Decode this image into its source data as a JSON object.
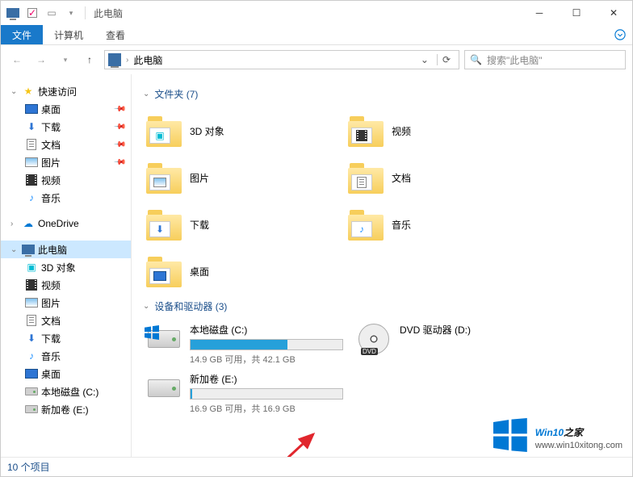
{
  "title": "此电脑",
  "ribbon": {
    "file": "文件",
    "computer": "计算机",
    "view": "查看"
  },
  "breadcrumb": "此电脑",
  "search_placeholder": "搜索\"此电脑\"",
  "sidebar": {
    "quick_access": "快速访问",
    "items_quick": [
      {
        "label": "桌面",
        "icon": "desktop",
        "pinned": true
      },
      {
        "label": "下载",
        "icon": "download",
        "pinned": true
      },
      {
        "label": "文档",
        "icon": "doc",
        "pinned": true
      },
      {
        "label": "图片",
        "icon": "img",
        "pinned": true
      },
      {
        "label": "视频",
        "icon": "video",
        "pinned": false
      },
      {
        "label": "音乐",
        "icon": "music",
        "pinned": false
      }
    ],
    "onedrive": "OneDrive",
    "this_pc": "此电脑",
    "items_pc": [
      {
        "label": "3D 对象",
        "icon": "3d"
      },
      {
        "label": "视频",
        "icon": "video"
      },
      {
        "label": "图片",
        "icon": "img"
      },
      {
        "label": "文档",
        "icon": "doc"
      },
      {
        "label": "下载",
        "icon": "download"
      },
      {
        "label": "音乐",
        "icon": "music"
      },
      {
        "label": "桌面",
        "icon": "desktop"
      },
      {
        "label": "本地磁盘 (C:)",
        "icon": "drive"
      },
      {
        "label": "新加卷 (E:)",
        "icon": "drive"
      }
    ]
  },
  "groups": {
    "folders_header": "文件夹 (7)",
    "folders": [
      {
        "label": "3D 对象",
        "inner": "3d"
      },
      {
        "label": "视频",
        "inner": "video"
      },
      {
        "label": "图片",
        "inner": "img"
      },
      {
        "label": "文档",
        "inner": "doc"
      },
      {
        "label": "下载",
        "inner": "download"
      },
      {
        "label": "音乐",
        "inner": "music"
      },
      {
        "label": "桌面",
        "inner": "desktop"
      }
    ],
    "drives_header": "设备和驱动器 (3)",
    "drives": [
      {
        "name": "本地磁盘 (C:)",
        "info": "14.9 GB 可用，共 42.1 GB",
        "fill": 64,
        "type": "hdd",
        "os": true
      },
      {
        "name": "DVD 驱动器 (D:)",
        "info": "",
        "type": "dvd"
      },
      {
        "name": "新加卷 (E:)",
        "info": "16.9 GB 可用，共 16.9 GB",
        "fill": 1,
        "type": "hdd",
        "os": false
      }
    ]
  },
  "status": "10 个项目",
  "watermark": {
    "brand_a": "Win10",
    "brand_b": "之家",
    "url": "www.win10xitong.com"
  },
  "dvd_label": "DVD"
}
